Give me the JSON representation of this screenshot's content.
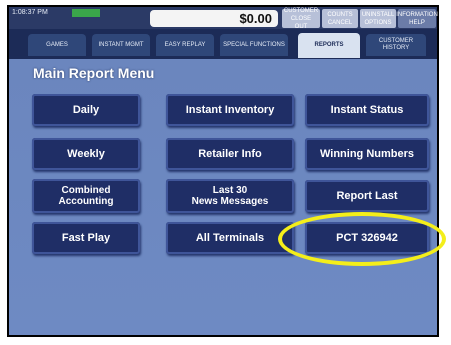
{
  "header": {
    "time_label": "1:08:37 PM",
    "balance": "$0.00",
    "top_buttons": [
      "CUSTOMER CLOSE OUT",
      "COUNTS CANCEL",
      "UNINSTALL OPTIONS",
      "INFORMATION HELP"
    ]
  },
  "tabs": [
    {
      "label": "GAMES"
    },
    {
      "label": "INSTANT MGMT"
    },
    {
      "label": "EASY REPLAY"
    },
    {
      "label": "SPECIAL FUNCTIONS"
    },
    {
      "label": "REPORTS",
      "active": true
    },
    {
      "label": "CUSTOMER HISTORY"
    }
  ],
  "main": {
    "title": "Main Report Menu",
    "buttons": {
      "daily": "Daily",
      "instant_inventory": "Instant Inventory",
      "instant_status": "Instant Status",
      "weekly": "Weekly",
      "retailer_info": "Retailer Info",
      "winning_numbers": "Winning Numbers",
      "combined_accounting_1": "Combined",
      "combined_accounting_2": "Accounting",
      "last30_1": "Last 30",
      "last30_2": "News Messages",
      "report_last": "Report Last",
      "fast_play": "Fast Play",
      "all_terminals": "All Terminals",
      "pct": "PCT 326942"
    }
  },
  "colors": {
    "panel": "#6d88c0",
    "button": "#1f2e66",
    "highlight": "#f4ee1a"
  }
}
